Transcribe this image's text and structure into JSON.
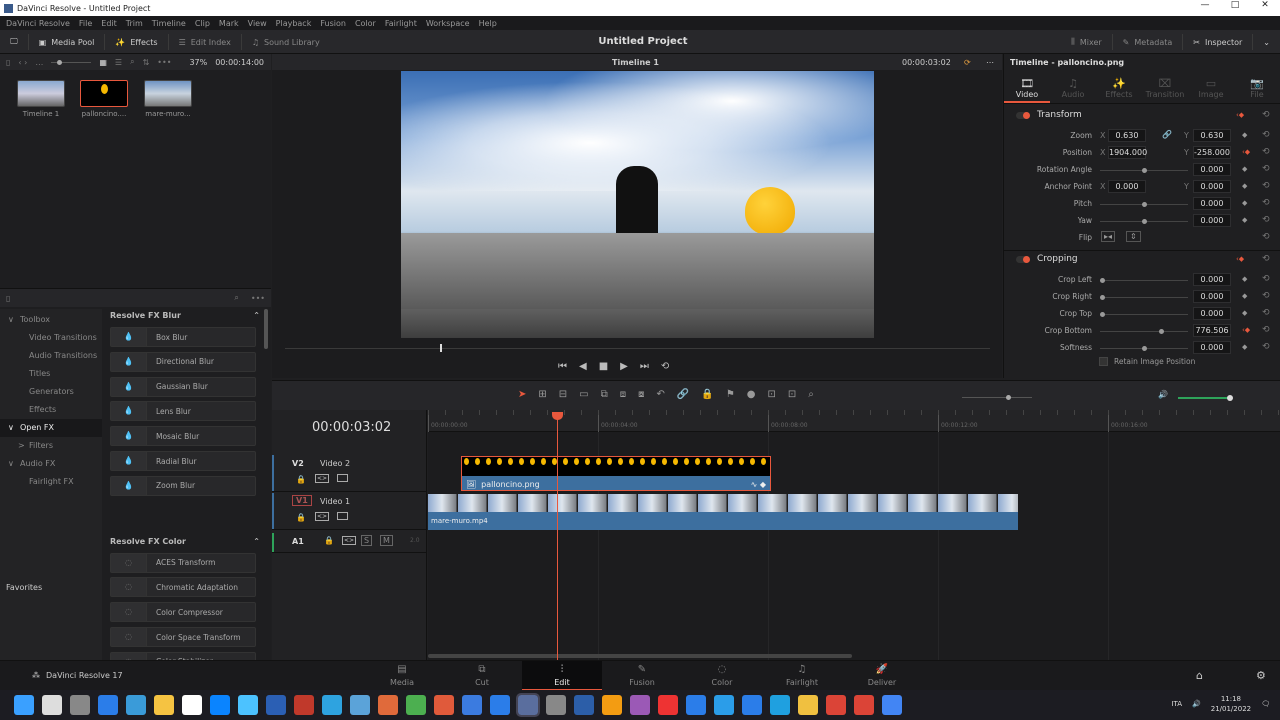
{
  "window": {
    "title": "DaVinci Resolve - Untitled Project",
    "min": "—",
    "max": "□",
    "close": "✕"
  },
  "menu": [
    "DaVinci Resolve",
    "File",
    "Edit",
    "Trim",
    "Timeline",
    "Clip",
    "Mark",
    "View",
    "Playback",
    "Fusion",
    "Color",
    "Fairlight",
    "Workspace",
    "Help"
  ],
  "toolbar": {
    "media_pool": "Media Pool",
    "effects": "Effects",
    "edit_index": "Edit Index",
    "sound_library": "Sound Library",
    "project_title": "Untitled Project",
    "mixer": "Mixer",
    "metadata": "Metadata",
    "inspector": "Inspector"
  },
  "media_pool": {
    "clips": [
      {
        "name": "Timeline 1"
      },
      {
        "name": "palloncino...."
      },
      {
        "name": "mare-muro..."
      }
    ]
  },
  "viewer": {
    "zoom": "37%",
    "duration": "00:00:14:00",
    "timeline_name": "Timeline 1",
    "timecode": "00:00:03:02"
  },
  "inspector": {
    "title": "Timeline - palloncino.png",
    "tabs": [
      "Video",
      "Audio",
      "Effects",
      "Transition",
      "Image",
      "File"
    ],
    "transform_label": "Transform",
    "cropping_label": "Cropping",
    "zoom": {
      "label": "Zoom",
      "x": "0.630",
      "y": "0.630"
    },
    "position": {
      "label": "Position",
      "x": "1904.000",
      "y": "-258.000"
    },
    "rotation": {
      "label": "Rotation Angle",
      "value": "0.000",
      "slider": 0.5
    },
    "anchor": {
      "label": "Anchor Point",
      "x": "0.000",
      "y": "0.000"
    },
    "pitch": {
      "label": "Pitch",
      "value": "0.000",
      "slider": 0.5
    },
    "yaw": {
      "label": "Yaw",
      "value": "0.000",
      "slider": 0.5
    },
    "flip_label": "Flip",
    "crop": [
      {
        "label": "Crop Left",
        "value": "0.000",
        "slider": 0
      },
      {
        "label": "Crop Right",
        "value": "0.000",
        "slider": 0
      },
      {
        "label": "Crop Top",
        "value": "0.000",
        "slider": 0
      },
      {
        "label": "Crop Bottom",
        "value": "776.506",
        "slider": 0.7
      },
      {
        "label": "Softness",
        "value": "0.000",
        "slider": 0.5
      }
    ],
    "retain": "Retain Image Position",
    "x": "X",
    "y": "Y"
  },
  "effects": {
    "sidebar": [
      {
        "label": "Toolbox",
        "level": 0,
        "arrow": "∨"
      },
      {
        "label": "Video Transitions",
        "level": 1
      },
      {
        "label": "Audio Transitions",
        "level": 1
      },
      {
        "label": "Titles",
        "level": 1
      },
      {
        "label": "Generators",
        "level": 1
      },
      {
        "label": "Effects",
        "level": 1
      },
      {
        "label": "Open FX",
        "level": 0,
        "arrow": "∨",
        "active": true
      },
      {
        "label": "Filters",
        "level": 1,
        "arrow": ">"
      },
      {
        "label": "Audio FX",
        "level": 0,
        "arrow": "∨"
      },
      {
        "label": "Fairlight FX",
        "level": 1
      }
    ],
    "favorites": "Favorites",
    "groups": [
      {
        "title": "Resolve FX Blur",
        "items": [
          "Box Blur",
          "Directional Blur",
          "Gaussian Blur",
          "Lens Blur",
          "Mosaic Blur",
          "Radial Blur",
          "Zoom Blur"
        ]
      },
      {
        "title": "Resolve FX Color",
        "items": [
          "ACES Transform",
          "Chromatic Adaptation",
          "Color Compressor",
          "Color Space Transform",
          "Color Stabilizer"
        ]
      }
    ]
  },
  "timeline": {
    "timecode": "00:00:03:02",
    "ruler": [
      "00:00:00:00",
      "00:00:04:00",
      "00:00:08:00",
      "00:00:12:00",
      "00:00:16:00"
    ],
    "tracks": [
      {
        "id": "V2",
        "name": "Video 2"
      },
      {
        "id": "V1",
        "name": "Video 1"
      },
      {
        "id": "A1",
        "channels": "2.0",
        "solo": "S",
        "mute": "M"
      }
    ],
    "clips": {
      "v2": "palloncino.png",
      "v1": "mare-muro.mp4"
    }
  },
  "pages": {
    "app": "DaVinci Resolve 17",
    "items": [
      "Media",
      "Cut",
      "Edit",
      "Fusion",
      "Color",
      "Fairlight",
      "Deliver"
    ],
    "active": "Edit"
  },
  "taskbar": {
    "lang": "ITA",
    "time": "11:18",
    "date": "21/01/2022"
  },
  "colors": {
    "accent": "#e8583d",
    "clip_blue": "#3d6f9f",
    "balloon": "#f5b800"
  }
}
